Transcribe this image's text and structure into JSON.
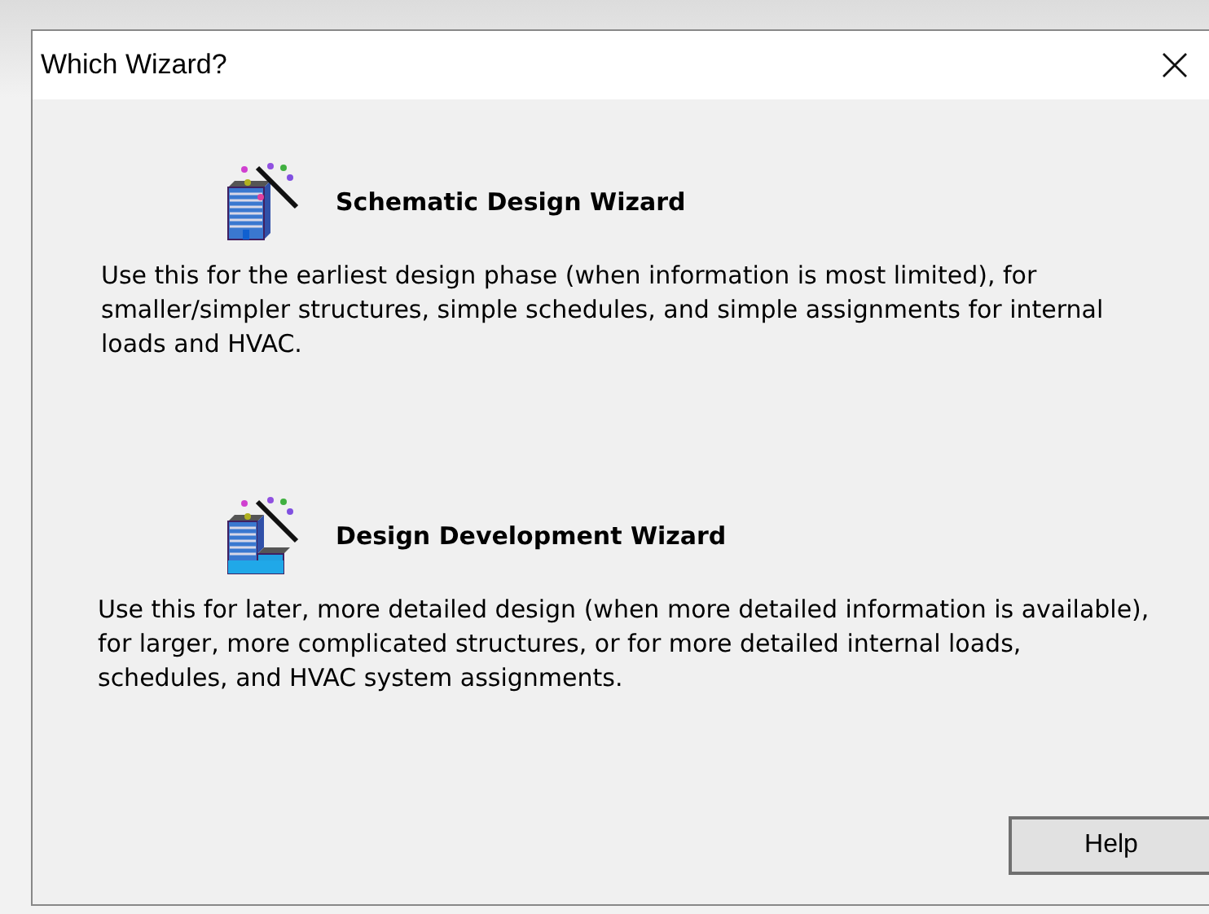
{
  "window": {
    "title": "Which Wizard?"
  },
  "wizards": [
    {
      "kind": "tower",
      "title": "Schematic Design Wizard",
      "description": "Use this for the earliest design phase (when information is most limited), for smaller/simpler structures, simple schedules, and simple assignments for internal loads and HVAC."
    },
    {
      "kind": "stepped",
      "title": "Design Development Wizard",
      "description": "Use this for later, more detailed design (when more detailed information is available), for larger, more complicated structures, or for more detailed internal loads, schedules, and HVAC system assignments."
    }
  ],
  "buttons": [
    "Help"
  ]
}
